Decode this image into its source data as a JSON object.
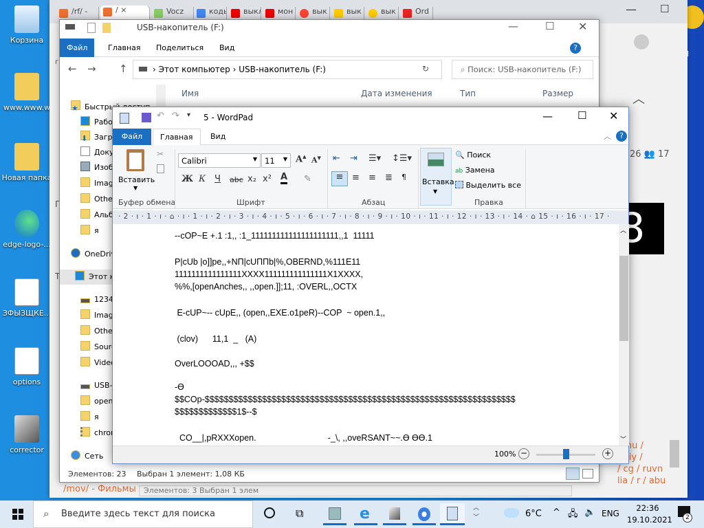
{
  "desktop": {
    "icons": [
      {
        "label": "Корзина"
      },
      {
        "label": "www.www.w"
      },
      {
        "label": "Новая папка"
      },
      {
        "label": "edge-logo-..."
      },
      {
        "label": "ЗФЫЗЩКЕ..."
      },
      {
        "label": "options"
      },
      {
        "label": "corrector"
      }
    ]
  },
  "browser": {
    "tabs": [
      "/rf/ -",
      "/ ×",
      "Vocz",
      "коды",
      "выкл",
      "мон",
      "вык",
      "вык",
      "вык",
      "Ord"
    ],
    "side_text": "26",
    "side_count": "17",
    "big_glyph": "8",
    "links": [
      "/ mu /",
      "/ diy /",
      "/ cg / ruvn",
      "lia / r / abu"
    ],
    "bottom_link": "/mov/ - Фильмы",
    "behind_status": "Элементов: 3     Выбран 1 элем",
    "side_tail": "-И"
  },
  "explorer": {
    "title": "USB-накопитель (F:)",
    "ribbon_tabs": [
      "Файл",
      "Главная",
      "Поделиться",
      "Вид"
    ],
    "breadcrumb": [
      "Этот компьютер",
      "USB-накопитель (F:)"
    ],
    "search_placeholder": "Поиск: USB-накопитель (F:)",
    "columns": [
      "Имя",
      "Дата изменения",
      "Тип",
      "Размер"
    ],
    "nav": [
      {
        "label": "Быстрый доступ",
        "type": "star"
      },
      {
        "label": "Рабочий стол",
        "type": "desktop"
      },
      {
        "label": "Загрузки",
        "type": "down"
      },
      {
        "label": "Документы",
        "type": "doc"
      },
      {
        "label": "Изображения",
        "type": "img"
      },
      {
        "label": "Images",
        "type": "folder"
      },
      {
        "label": "Other",
        "type": "folder"
      },
      {
        "label": "Альбом",
        "type": "folder"
      },
      {
        "label": "я",
        "type": "folder"
      },
      {
        "label": "OneDrive",
        "type": "cloud"
      },
      {
        "label": "Этот компьютер",
        "type": "pc"
      },
      {
        "label": "123456",
        "type": "drive"
      },
      {
        "label": "Images",
        "type": "folder"
      },
      {
        "label": "Other",
        "type": "folder"
      },
      {
        "label": "Source",
        "type": "folder"
      },
      {
        "label": "Video",
        "type": "folder"
      },
      {
        "label": "USB-накопитель",
        "type": "drive"
      },
      {
        "label": "open",
        "type": "folder"
      },
      {
        "label": "я",
        "type": "folder"
      },
      {
        "label": "chrome",
        "type": "zip"
      },
      {
        "label": "Сеть",
        "type": "net"
      }
    ],
    "status_count": "Элементов: 23",
    "status_selected": "Выбран 1 элемент: 1,08 КБ",
    "left_labels": [
      "П",
      "Т",
      "г"
    ]
  },
  "wordpad": {
    "title": "5 - WordPad",
    "tabs": [
      "Файл",
      "Главная",
      "Вид"
    ],
    "paste": "Вставить",
    "clipboard": "Буфер обмена",
    "font_name": "Calibri",
    "font_size": "11",
    "font_group": "Шрифт",
    "para_group": "Абзац",
    "insert": "Вставка",
    "find": "Поиск",
    "replace": "Замена",
    "select_all": "Выделить все",
    "edit_group": "Правка",
    "bold": "Ж",
    "italic": "К",
    "underline": "Ч",
    "strike": "abc",
    "sub": "x₂",
    "sup": "x²",
    "ruler": "· 2 · ı · 1 · ı · ⌂ · ı · 1 · ı · 2 · ı · 3 · ı · 4 · ı · 5 · ı · 6 · ı · 7 · ı · 8 · ı · 9 · ı · 10 · ı · 11 · ı · 12 · ı · 13 · ı · 14 · ⌂ 15 · ı · 16 · ı · 17 ·",
    "lines": [
      "--cOP~E +.1 :1,, :1_111111111111111111111,,1  11111",
      "P|cUb |o]]pe,,+NП|cUППb|%,OBERND,%111E11",
      "1111111111111111XXXX111111111111111X1XXXX,",
      "%%,[openAnches,, ,,open.]];11, :OVERL,,OCTX",
      " E-cUP~-- cUpE,, (open,,EXE.o1peR)--COP  ~ open.1,,",
      " (clov)      11,1  _   (A)",
      "OverLOOOAD,,, +$$",
      "-ϴ",
      "$$COp-$$$$$$$$$$$$$$$$$$$$$$$$$$$$$$$$$$$$$$$$$$$$$$$$$$$$$$$$$$$$$$$$$",
      "$$$$$$$$$$$$$1$--$",
      "  CO__|,pRXXXopen.                              -_\\, ,,oveRSANT~~.ϴ ϴϴ.1"
    ],
    "zoom": "100%",
    "zoom_level": 100
  },
  "taskbar": {
    "search_placeholder": "Введите здесь текст для поиска",
    "weather": "6°C",
    "lang": "ENG",
    "time": "22:36",
    "date": "19.10.2021",
    "notifications": "2"
  }
}
